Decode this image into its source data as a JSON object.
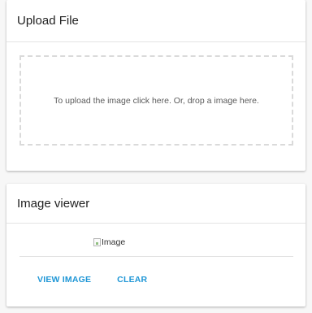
{
  "upload_card": {
    "title": "Upload File",
    "dropzone_text": "To upload the image click here. Or, drop a image here."
  },
  "viewer_card": {
    "title": "Image viewer",
    "image_alt": "Image",
    "buttons": {
      "view": "VIEW IMAGE",
      "clear": "CLEAR"
    }
  },
  "colors": {
    "accent": "#1e96d6",
    "background": "#f7f7f7",
    "card": "#ffffff"
  }
}
